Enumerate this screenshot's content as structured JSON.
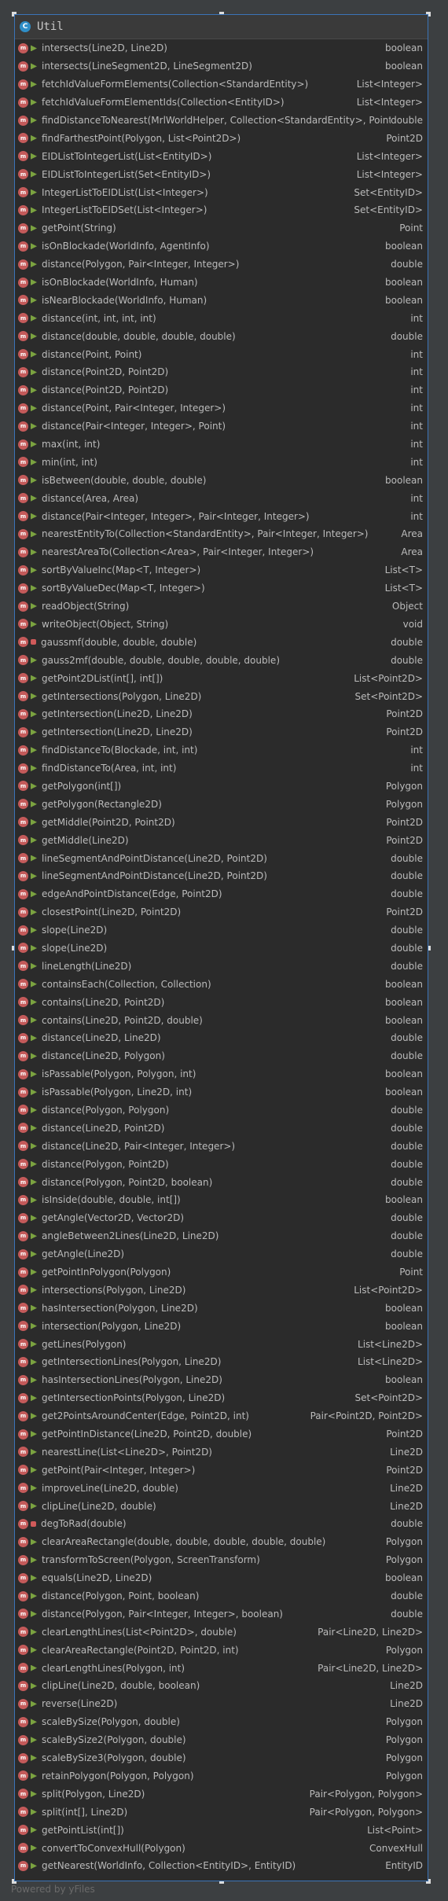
{
  "class": {
    "icon_letter": "C",
    "name": "Util"
  },
  "footer": "Powered by yFiles",
  "methods": [
    {
      "sig": "intersects(Line2D, Line2D)",
      "ret": "boolean",
      "vis": "public"
    },
    {
      "sig": "intersects(LineSegment2D, LineSegment2D)",
      "ret": "boolean",
      "vis": "public"
    },
    {
      "sig": "fetchIdValueFormElements(Collection<StandardEntity>)",
      "ret": "List<Integer>",
      "vis": "public"
    },
    {
      "sig": "fetchIdValueFormElementIds(Collection<EntityID>)",
      "ret": "List<Integer>",
      "vis": "public"
    },
    {
      "sig": "findDistanceToNearest(MrlWorldHelper, Collection<StandardEntity>, Point)",
      "ret": "double",
      "vis": "public"
    },
    {
      "sig": "findFarthestPoint(Polygon, List<Point2D>)",
      "ret": "Point2D",
      "vis": "public"
    },
    {
      "sig": "EIDListToIntegerList(List<EntityID>)",
      "ret": "List<Integer>",
      "vis": "public"
    },
    {
      "sig": "EIDListToIntegerList(Set<EntityID>)",
      "ret": "List<Integer>",
      "vis": "public"
    },
    {
      "sig": "IntegerListToEIDList(List<Integer>)",
      "ret": "Set<EntityID>",
      "vis": "public"
    },
    {
      "sig": "IntegerListToEIDSet(List<Integer>)",
      "ret": "Set<EntityID>",
      "vis": "public"
    },
    {
      "sig": "getPoint(String)",
      "ret": "Point",
      "vis": "public"
    },
    {
      "sig": "isOnBlockade(WorldInfo, AgentInfo)",
      "ret": "boolean",
      "vis": "public"
    },
    {
      "sig": "distance(Polygon, Pair<Integer, Integer>)",
      "ret": "double",
      "vis": "public"
    },
    {
      "sig": "isOnBlockade(WorldInfo, Human)",
      "ret": "boolean",
      "vis": "public"
    },
    {
      "sig": "isNearBlockade(WorldInfo, Human)",
      "ret": "boolean",
      "vis": "public"
    },
    {
      "sig": "distance(int, int, int, int)",
      "ret": "int",
      "vis": "public"
    },
    {
      "sig": "distance(double, double, double, double)",
      "ret": "double",
      "vis": "public"
    },
    {
      "sig": "distance(Point, Point)",
      "ret": "int",
      "vis": "public"
    },
    {
      "sig": "distance(Point2D, Point2D)",
      "ret": "int",
      "vis": "public"
    },
    {
      "sig": "distance(Point2D, Point2D)",
      "ret": "int",
      "vis": "public"
    },
    {
      "sig": "distance(Point, Pair<Integer, Integer>)",
      "ret": "int",
      "vis": "public"
    },
    {
      "sig": "distance(Pair<Integer, Integer>, Point)",
      "ret": "int",
      "vis": "public"
    },
    {
      "sig": "max(int, int)",
      "ret": "int",
      "vis": "public"
    },
    {
      "sig": "min(int, int)",
      "ret": "int",
      "vis": "public"
    },
    {
      "sig": "isBetween(double, double, double)",
      "ret": "boolean",
      "vis": "public"
    },
    {
      "sig": "distance(Area, Area)",
      "ret": "int",
      "vis": "public"
    },
    {
      "sig": "distance(Pair<Integer, Integer>, Pair<Integer, Integer>)",
      "ret": "int",
      "vis": "public"
    },
    {
      "sig": "nearestEntityTo(Collection<StandardEntity>, Pair<Integer, Integer>)",
      "ret": "Area",
      "vis": "public"
    },
    {
      "sig": "nearestAreaTo(Collection<Area>, Pair<Integer, Integer>)",
      "ret": "Area",
      "vis": "public"
    },
    {
      "sig": "sortByValueInc(Map<T, Integer>)",
      "ret": "List<T>",
      "vis": "public"
    },
    {
      "sig": "sortByValueDec(Map<T, Integer>)",
      "ret": "List<T>",
      "vis": "public"
    },
    {
      "sig": "readObject(String)",
      "ret": "Object",
      "vis": "public"
    },
    {
      "sig": "writeObject(Object, String)",
      "ret": "void",
      "vis": "public"
    },
    {
      "sig": "gaussmf(double, double, double)",
      "ret": "double",
      "vis": "private"
    },
    {
      "sig": "gauss2mf(double, double, double, double, double)",
      "ret": "double",
      "vis": "public"
    },
    {
      "sig": "getPoint2DList(int[], int[])",
      "ret": "List<Point2D>",
      "vis": "public"
    },
    {
      "sig": "getIntersections(Polygon, Line2D)",
      "ret": "Set<Point2D>",
      "vis": "public"
    },
    {
      "sig": "getIntersection(Line2D, Line2D)",
      "ret": "Point2D",
      "vis": "public"
    },
    {
      "sig": "getIntersection(Line2D, Line2D)",
      "ret": "Point2D",
      "vis": "public"
    },
    {
      "sig": "findDistanceTo(Blockade, int, int)",
      "ret": "int",
      "vis": "public"
    },
    {
      "sig": "findDistanceTo(Area, int, int)",
      "ret": "int",
      "vis": "public"
    },
    {
      "sig": "getPolygon(int[])",
      "ret": "Polygon",
      "vis": "public"
    },
    {
      "sig": "getPolygon(Rectangle2D)",
      "ret": "Polygon",
      "vis": "public"
    },
    {
      "sig": "getMiddle(Point2D, Point2D)",
      "ret": "Point2D",
      "vis": "public"
    },
    {
      "sig": "getMiddle(Line2D)",
      "ret": "Point2D",
      "vis": "public"
    },
    {
      "sig": "lineSegmentAndPointDistance(Line2D, Point2D)",
      "ret": "double",
      "vis": "public"
    },
    {
      "sig": "lineSegmentAndPointDistance(Line2D, Point2D)",
      "ret": "double",
      "vis": "public"
    },
    {
      "sig": "edgeAndPointDistance(Edge, Point2D)",
      "ret": "double",
      "vis": "public"
    },
    {
      "sig": "closestPoint(Line2D, Point2D)",
      "ret": "Point2D",
      "vis": "public"
    },
    {
      "sig": "slope(Line2D)",
      "ret": "double",
      "vis": "public"
    },
    {
      "sig": "slope(Line2D)",
      "ret": "double",
      "vis": "public"
    },
    {
      "sig": "lineLength(Line2D)",
      "ret": "double",
      "vis": "public"
    },
    {
      "sig": "containsEach(Collection, Collection)",
      "ret": "boolean",
      "vis": "public"
    },
    {
      "sig": "contains(Line2D, Point2D)",
      "ret": "boolean",
      "vis": "public"
    },
    {
      "sig": "contains(Line2D, Point2D, double)",
      "ret": "boolean",
      "vis": "public"
    },
    {
      "sig": "distance(Line2D, Line2D)",
      "ret": "double",
      "vis": "public"
    },
    {
      "sig": "distance(Line2D, Polygon)",
      "ret": "double",
      "vis": "public"
    },
    {
      "sig": "isPassable(Polygon, Polygon, int)",
      "ret": "boolean",
      "vis": "public"
    },
    {
      "sig": "isPassable(Polygon, Line2D, int)",
      "ret": "boolean",
      "vis": "public"
    },
    {
      "sig": "distance(Polygon, Polygon)",
      "ret": "double",
      "vis": "public"
    },
    {
      "sig": "distance(Line2D, Point2D)",
      "ret": "double",
      "vis": "public"
    },
    {
      "sig": "distance(Line2D, Pair<Integer, Integer>)",
      "ret": "double",
      "vis": "public"
    },
    {
      "sig": "distance(Polygon, Point2D)",
      "ret": "double",
      "vis": "public"
    },
    {
      "sig": "distance(Polygon, Point2D, boolean)",
      "ret": "double",
      "vis": "public"
    },
    {
      "sig": "isInside(double, double, int[])",
      "ret": "boolean",
      "vis": "public"
    },
    {
      "sig": "getAngle(Vector2D, Vector2D)",
      "ret": "double",
      "vis": "public"
    },
    {
      "sig": "angleBetween2Lines(Line2D, Line2D)",
      "ret": "double",
      "vis": "public"
    },
    {
      "sig": "getAngle(Line2D)",
      "ret": "double",
      "vis": "public"
    },
    {
      "sig": "getPointInPolygon(Polygon)",
      "ret": "Point",
      "vis": "public"
    },
    {
      "sig": "intersections(Polygon, Line2D)",
      "ret": "List<Point2D>",
      "vis": "public"
    },
    {
      "sig": "hasIntersection(Polygon, Line2D)",
      "ret": "boolean",
      "vis": "public"
    },
    {
      "sig": "intersection(Polygon, Line2D)",
      "ret": "boolean",
      "vis": "public"
    },
    {
      "sig": "getLines(Polygon)",
      "ret": "List<Line2D>",
      "vis": "public"
    },
    {
      "sig": "getIntersectionLines(Polygon, Line2D)",
      "ret": "List<Line2D>",
      "vis": "public"
    },
    {
      "sig": "hasIntersectionLines(Polygon, Line2D)",
      "ret": "boolean",
      "vis": "public"
    },
    {
      "sig": "getIntersectionPoints(Polygon, Line2D)",
      "ret": "Set<Point2D>",
      "vis": "public"
    },
    {
      "sig": "get2PointsAroundCenter(Edge, Point2D, int)",
      "ret": "Pair<Point2D, Point2D>",
      "vis": "public"
    },
    {
      "sig": "getPointInDistance(Line2D, Point2D, double)",
      "ret": "Point2D",
      "vis": "public"
    },
    {
      "sig": "nearestLine(List<Line2D>, Point2D)",
      "ret": "Line2D",
      "vis": "public"
    },
    {
      "sig": "getPoint(Pair<Integer, Integer>)",
      "ret": "Point2D",
      "vis": "public"
    },
    {
      "sig": "improveLine(Line2D, double)",
      "ret": "Line2D",
      "vis": "public"
    },
    {
      "sig": "clipLine(Line2D, double)",
      "ret": "Line2D",
      "vis": "public"
    },
    {
      "sig": "degToRad(double)",
      "ret": "double",
      "vis": "private"
    },
    {
      "sig": "clearAreaRectangle(double, double, double, double, double)",
      "ret": "Polygon",
      "vis": "public"
    },
    {
      "sig": "transformToScreen(Polygon, ScreenTransform)",
      "ret": "Polygon",
      "vis": "public"
    },
    {
      "sig": "equals(Line2D, Line2D)",
      "ret": "boolean",
      "vis": "public"
    },
    {
      "sig": "distance(Polygon, Point, boolean)",
      "ret": "double",
      "vis": "public"
    },
    {
      "sig": "distance(Polygon, Pair<Integer, Integer>, boolean)",
      "ret": "double",
      "vis": "public"
    },
    {
      "sig": "clearLengthLines(List<Point2D>, double)",
      "ret": "Pair<Line2D, Line2D>",
      "vis": "public"
    },
    {
      "sig": "clearAreaRectangle(Point2D, Point2D, int)",
      "ret": "Polygon",
      "vis": "public"
    },
    {
      "sig": "clearLengthLines(Polygon, int)",
      "ret": "Pair<Line2D, Line2D>",
      "vis": "public"
    },
    {
      "sig": "clipLine(Line2D, double, boolean)",
      "ret": "Line2D",
      "vis": "public"
    },
    {
      "sig": "reverse(Line2D)",
      "ret": "Line2D",
      "vis": "public"
    },
    {
      "sig": "scaleBySize(Polygon, double)",
      "ret": "Polygon",
      "vis": "public"
    },
    {
      "sig": "scaleBySize2(Polygon, double)",
      "ret": "Polygon",
      "vis": "public"
    },
    {
      "sig": "scaleBySize3(Polygon, double)",
      "ret": "Polygon",
      "vis": "public"
    },
    {
      "sig": "retainPolygon(Polygon, Polygon)",
      "ret": "Polygon",
      "vis": "public"
    },
    {
      "sig": "split(Polygon, Line2D)",
      "ret": "Pair<Polygon, Polygon>",
      "vis": "public"
    },
    {
      "sig": "split(int[], Line2D)",
      "ret": "Pair<Polygon, Polygon>",
      "vis": "public"
    },
    {
      "sig": "getPointList(int[])",
      "ret": "List<Point>",
      "vis": "public"
    },
    {
      "sig": "convertToConvexHull(Polygon)",
      "ret": "ConvexHull",
      "vis": "public"
    },
    {
      "sig": "getNearest(WorldInfo, Collection<EntityID>, EntityID)",
      "ret": "EntityID",
      "vis": "public"
    }
  ]
}
